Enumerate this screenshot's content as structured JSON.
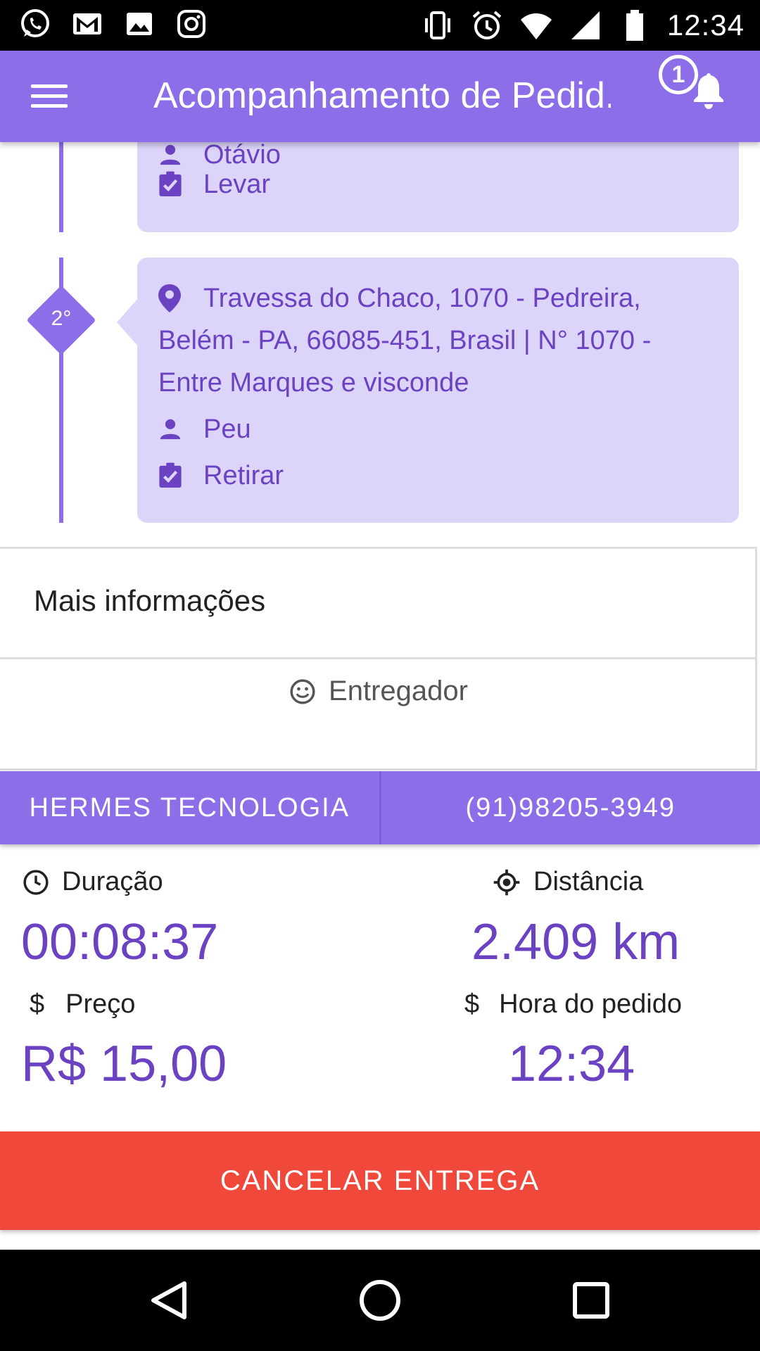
{
  "status_bar": {
    "time": "12:34",
    "left_icons": [
      "whatsapp-icon",
      "gmail-icon",
      "image-icon",
      "instagram-icon"
    ],
    "right_icons": [
      "vibrate-icon",
      "alarm-icon",
      "wifi-icon",
      "signal-icon",
      "battery-icon"
    ]
  },
  "app_bar": {
    "title": "Acompanhamento de Pedid..",
    "notification_count": "1"
  },
  "timeline": {
    "first_stop": {
      "name_partial": "Otávio",
      "action": "Levar"
    },
    "second_stop": {
      "step": "2°",
      "address": "Travessa do Chaco, 1070 - Pedreira, Belém - PA, 66085-451, Brasil | N° 1070 - Entre Marques e visconde",
      "name": "Peu",
      "action": "Retirar"
    }
  },
  "more_info": {
    "title": "Mais informações",
    "courier_label": "Entregador"
  },
  "contact": {
    "company": "HERMES TECNOLOGIA",
    "phone": "(91)98205-3949"
  },
  "stats": {
    "duration_label": "Duração",
    "duration_value": "00:08:37",
    "distance_label": "Distância",
    "distance_value": "2.409 km",
    "price_label": "Preço",
    "price_value": "R$ 15,00",
    "order_time_label": "Hora do pedido",
    "order_time_value": "12:34"
  },
  "cancel_button": "CANCELAR ENTREGA",
  "colors": {
    "primary": "#8b6ee8",
    "card_bg": "#dcd4f9",
    "text_purple": "#6a42c2",
    "cancel_red": "#f0493c"
  }
}
